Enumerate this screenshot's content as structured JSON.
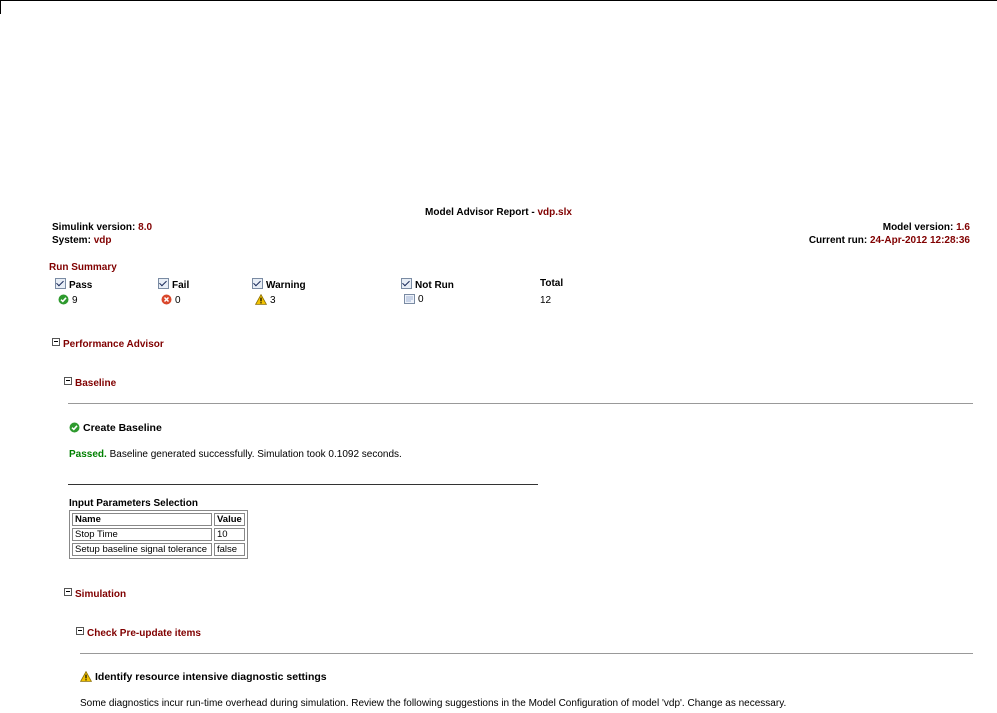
{
  "report": {
    "title_prefix": "Model Advisor Report - ",
    "title_model": "vdp.slx",
    "simulink_label": "Simulink version: ",
    "simulink_version": "8.0",
    "system_label": "System: ",
    "system_value": "vdp",
    "model_version_label": "Model version: ",
    "model_version": "1.6",
    "current_run_label": "Current run: ",
    "current_run": "24-Apr-2012 12:28:36"
  },
  "run_summary": {
    "heading": "Run Summary",
    "columns": [
      {
        "label": "Pass",
        "count": "9",
        "icon": "pass-icon"
      },
      {
        "label": "Fail",
        "count": "0",
        "icon": "fail-icon"
      },
      {
        "label": "Warning",
        "count": "3",
        "icon": "warning-icon"
      },
      {
        "label": "Not Run",
        "count": "0",
        "icon": "not-run-icon"
      }
    ],
    "total_label": "Total",
    "total_value": "12"
  },
  "sections": {
    "performance_advisor": "Performance Advisor",
    "baseline": "Baseline",
    "create_baseline": "Create Baseline",
    "passed_label": "Passed.",
    "passed_message": " Baseline generated successfully. Simulation took 0.1092 seconds.",
    "input_params_title": "Input Parameters Selection",
    "params_headers": [
      "Name",
      "Value"
    ],
    "params_rows": [
      [
        "Stop Time",
        "10"
      ],
      [
        "Setup baseline signal tolerance",
        "false"
      ]
    ],
    "simulation": "Simulation",
    "check_preupdate": "Check Pre-update items",
    "identify_title": "Identify resource intensive diagnostic settings",
    "identify_message": "Some diagnostics incur run-time overhead during simulation. Review the following suggestions in the Model Configuration of model 'vdp'. Change as necessary."
  },
  "colors": {
    "link": "#800000",
    "passed": "#008000",
    "rule": "#999999"
  }
}
